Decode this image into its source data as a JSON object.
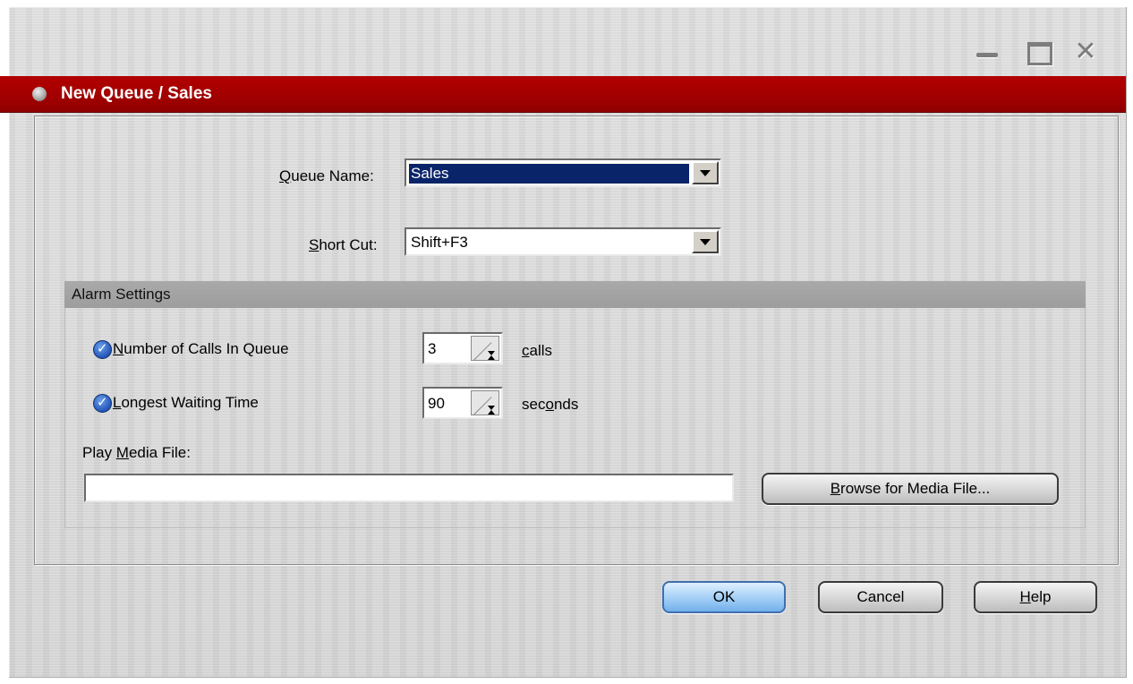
{
  "window": {
    "title": "New Queue / Sales",
    "controls": {
      "minimize": "minimize-icon",
      "maximize": "maximize-icon",
      "close": "close-icon"
    }
  },
  "form": {
    "queue_name": {
      "label_prefix": "",
      "label_accel": "Q",
      "label_rest": "ueue Name:",
      "value": "Sales"
    },
    "short_cut": {
      "label_accel": "S",
      "label_rest": "hort Cut:",
      "value": "Shift+F3"
    }
  },
  "alarm": {
    "header": "Alarm Settings",
    "calls": {
      "accel": "N",
      "rest": "umber of Calls In Queue",
      "value": "3",
      "unit_accel": "c",
      "unit_rest": "alls"
    },
    "wait": {
      "accel": "L",
      "rest": "ongest Waiting Time",
      "value": "90",
      "unit_pre": "sec",
      "unit_accel": "o",
      "unit_rest": "nds"
    },
    "media": {
      "label_pre": "Play ",
      "label_accel": "M",
      "label_rest": "edia File:",
      "value": ""
    },
    "browse": {
      "accel": "B",
      "rest": "rowse for Media File..."
    }
  },
  "buttons": {
    "ok": "OK",
    "cancel": "Cancel",
    "help_accel": "H",
    "help_rest": "elp"
  },
  "colors": {
    "titlebar": "#a30000",
    "selection": "#0a246a",
    "ok_button": "#a7d1f7"
  }
}
